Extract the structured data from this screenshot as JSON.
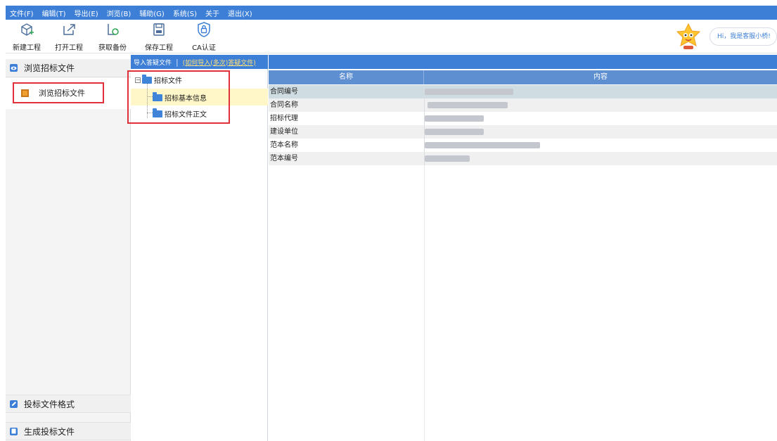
{
  "menubar": {
    "items": [
      "文件(F)",
      "编辑(T)",
      "导出(E)",
      "浏览(B)",
      "辅助(G)",
      "系统(S)",
      "关于",
      "退出(X)"
    ]
  },
  "toolbar": {
    "new_project": {
      "label": "新建工程",
      "icon": "new-project-icon"
    },
    "open_project": {
      "label": "打开工程",
      "icon": "open-project-icon"
    },
    "get_backup": {
      "label": "获取备份",
      "icon": "backup-icon"
    },
    "save_project": {
      "label": "保存工程",
      "icon": "save-icon"
    },
    "ca_auth": {
      "label": "CA认证",
      "icon": "lock-icon"
    }
  },
  "assistant": {
    "text": "Hi，我是客服小桥!"
  },
  "sidebar": {
    "browse_header": "浏览招标文件",
    "browse_item": "浏览招标文件",
    "bid_format": "投标文件格式",
    "generate_bid": "生成投标文件"
  },
  "tree": {
    "import_label": "导入答疑文件",
    "howto_label": "(如何导入(多次)答疑文件)",
    "root": "招标文件",
    "children": [
      "招标基本信息",
      "招标文件正文"
    ]
  },
  "grid": {
    "headers": {
      "name": "名称",
      "content": "内容"
    },
    "rows": [
      {
        "name": "合同编号"
      },
      {
        "name": "合同名称"
      },
      {
        "name": "招标代理"
      },
      {
        "name": "建设单位"
      },
      {
        "name": "范本名称"
      },
      {
        "name": "范本编号"
      }
    ]
  },
  "colors": {
    "accent": "#3d7fd6",
    "header": "#5e8fd1",
    "highlight": "#fff7c8",
    "annotation_red": "#e0303a"
  }
}
